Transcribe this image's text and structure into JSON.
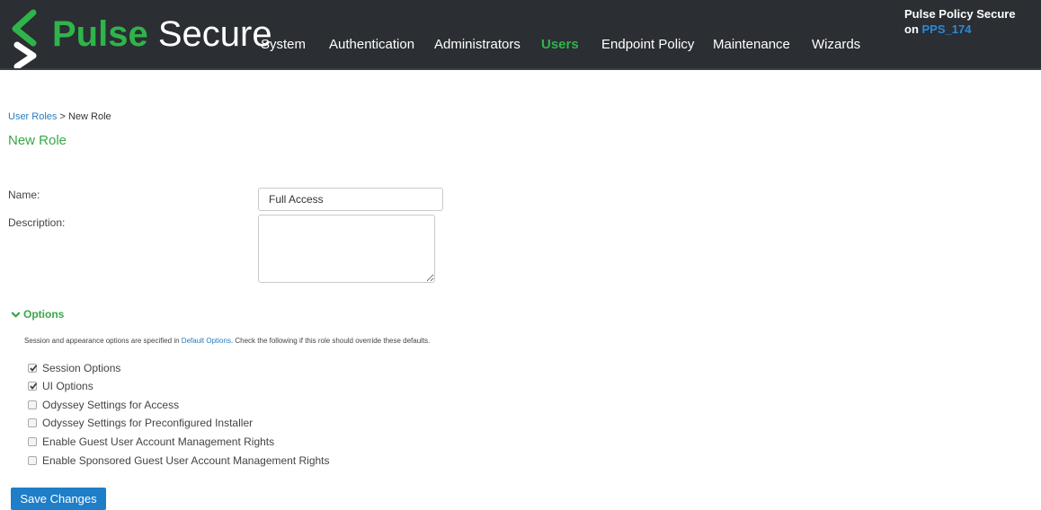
{
  "header": {
    "brand_part1": "Pulse",
    "brand_part2": "Secure",
    "nav": [
      "System",
      "Authentication",
      "Administrators",
      "Users",
      "Endpoint Policy",
      "Maintenance",
      "Wizards"
    ],
    "active_nav": "Users",
    "product": "Pulse Policy Secure",
    "on_label": "on",
    "host": "PPS_174"
  },
  "breadcrumb": {
    "link": "User Roles",
    "separator": ">",
    "current": "New Role"
  },
  "page_title": "New Role",
  "form": {
    "name_label": "Name:",
    "name_value": "Full Access",
    "description_label": "Description:",
    "description_value": ""
  },
  "options": {
    "toggle_label": "Options",
    "help_prefix": "Session and appearance options are specified in",
    "help_link": "Default Options",
    "help_suffix": ". Check the following if this role should override these defaults.",
    "items": [
      {
        "label": "Session Options",
        "checked": true
      },
      {
        "label": "UI Options",
        "checked": true
      },
      {
        "label": "Odyssey Settings for Access",
        "checked": false
      },
      {
        "label": "Odyssey Settings for Preconfigured Installer",
        "checked": false
      },
      {
        "label": "Enable Guest User Account Management Rights",
        "checked": false
      },
      {
        "label": "Enable Sponsored Guest User Account Management Rights",
        "checked": false
      }
    ]
  },
  "save_button": "Save Changes",
  "colors": {
    "header_bg": "#2b2e33",
    "brand_green": "#2fb44a",
    "link_blue": "#2a7bbf",
    "button_blue": "#1e7ec8"
  }
}
